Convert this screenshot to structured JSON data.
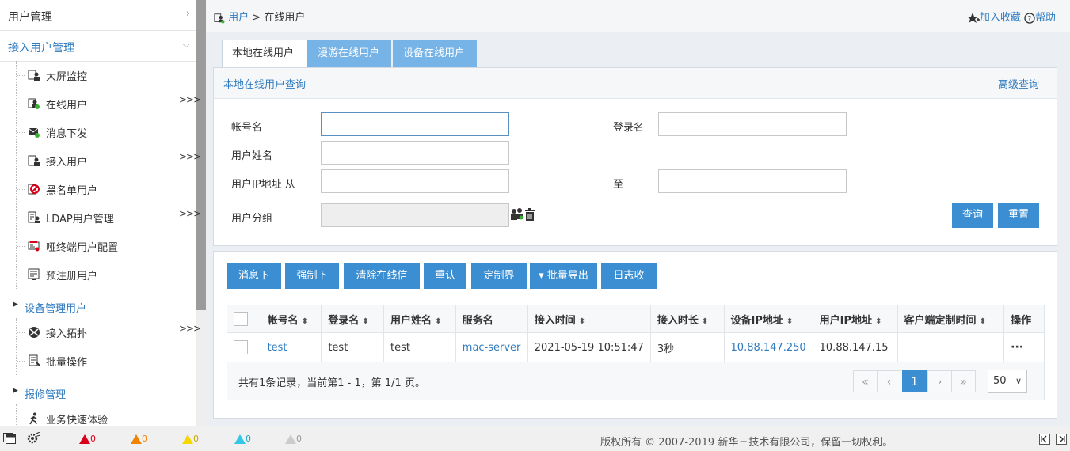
{
  "sidebar": {
    "top_section": "用户管理",
    "access_section": "接入用户管理",
    "items": [
      {
        "label": "大屏监控",
        "icon": "monitor-user-icon",
        "more": ""
      },
      {
        "label": "在线用户",
        "icon": "online-user-icon",
        "more": ">>>"
      },
      {
        "label": "消息下发",
        "icon": "message-icon",
        "more": ""
      },
      {
        "label": "接入用户",
        "icon": "access-user-icon",
        "more": ">>>"
      },
      {
        "label": "黑名单用户",
        "icon": "blacklist-icon",
        "more": ""
      },
      {
        "label": "LDAP用户管理",
        "icon": "ldap-icon",
        "more": ">>>"
      },
      {
        "label": "哑终端用户配置",
        "icon": "dumb-terminal-icon",
        "more": ""
      },
      {
        "label": "预注册用户",
        "icon": "preregister-icon",
        "more": ""
      }
    ],
    "device_group": "设备管理用户",
    "device_items": [
      {
        "label": "接入拓扑",
        "icon": "topology-icon",
        "more": ">>>"
      },
      {
        "label": "批量操作",
        "icon": "batch-icon",
        "more": ""
      }
    ],
    "repair_group": "报修管理",
    "repair_items": [
      {
        "label": "业务快速体验",
        "icon": "quick-experience-icon"
      }
    ]
  },
  "topbar": {
    "breadcrumb_root": "用户",
    "breadcrumb_sep": ">",
    "breadcrumb_current": "在线用户",
    "favorite": "加入收藏",
    "help": "帮助"
  },
  "tabs": [
    "本地在线用户",
    "漫游在线用户",
    "设备在线用户"
  ],
  "query": {
    "title": "本地在线用户查询",
    "advanced": "高级查询",
    "fields": {
      "account": {
        "label": "帐号名",
        "value": ""
      },
      "login": {
        "label": "登录名",
        "value": ""
      },
      "username": {
        "label": "用户姓名",
        "value": ""
      },
      "ip_from": {
        "label": "用户IP地址 从",
        "value": ""
      },
      "ip_to": {
        "label": "至",
        "value": ""
      },
      "group": {
        "label": "用户分组",
        "value": ""
      }
    },
    "search_btn": "查询",
    "reset_btn": "重置"
  },
  "actions": [
    "消息下发",
    "强制下线",
    "清除在线信息",
    "重认证",
    "定制界面",
    "批量导出",
    "日志收集"
  ],
  "table": {
    "columns": [
      "帐号名",
      "登录名",
      "用户姓名",
      "服务名",
      "接入时间",
      "接入时长",
      "设备IP地址",
      "用户IP地址",
      "客户端定制时间",
      "操作"
    ],
    "rows": [
      {
        "account": "test",
        "login": "test",
        "name": "test",
        "service": "mac-server",
        "time": "2021-05-19 10:51:47",
        "duration": "3秒",
        "device_ip": "10.88.147.250",
        "user_ip": "10.88.147.15",
        "custom_time": "",
        "op": "···"
      }
    ]
  },
  "pager": {
    "info": "共有1条记录，当前第1 - 1，第 1/1 页。",
    "first": "«",
    "prev": "‹",
    "current": "1",
    "next": "›",
    "last": "»",
    "page_size": "50"
  },
  "status": {
    "critical": "0",
    "major": "0",
    "minor": "0",
    "warning": "0",
    "info": "0",
    "copyright": "版权所有 © 2007-2019 新华三技术有限公司，保留一切权利。"
  },
  "colors": {
    "accent": "#3b8ed1",
    "link": "#2f7bbf",
    "tab_inactive": "#76b3e6",
    "critical": "#d9001b",
    "major": "#f08300",
    "minor": "#f5d800",
    "warning": "#33c6e6",
    "info": "#999999"
  }
}
